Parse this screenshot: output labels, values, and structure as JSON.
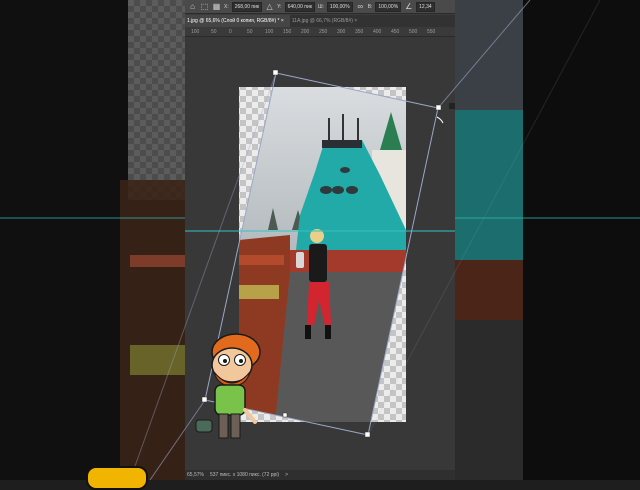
{
  "options_bar": {
    "x_label": "X:",
    "x_value": "268,00 пик",
    "y_label": "Y:",
    "y_value": "640,00 пик",
    "w_label": "Ш:",
    "w_value": "100,00%",
    "h_label": "В:",
    "h_value": "100,00%",
    "angle_value": "12,34"
  },
  "tabs": [
    {
      "label": "1.jpg @ 65,6% (Слой 0 копия, RGB/8#) *",
      "close": "×"
    },
    {
      "label": "11A.jpg @ 66,7% (RGB/8#)",
      "close": "×"
    }
  ],
  "ruler": {
    "ticks": [
      "100",
      "50",
      "0",
      "50",
      "100",
      "150",
      "200",
      "250",
      "300",
      "350",
      "400",
      "450",
      "500",
      "550"
    ]
  },
  "status_bar": {
    "zoom": "65,57%",
    "doc_info": "537 пикс. x 1080 пикс. (72 ppi)",
    "arrow": ">"
  },
  "colors": {
    "accent_teal": "#2fb3b0",
    "transform_line": "#9aa7c6",
    "guide": "#35c2c2",
    "character_hair": "#e26a1c",
    "character_shirt": "#79c34a"
  }
}
